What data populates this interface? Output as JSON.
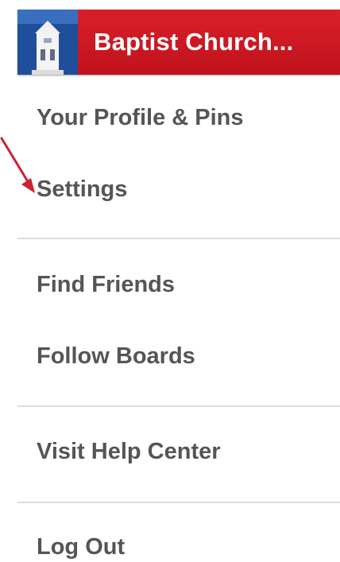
{
  "header": {
    "title": "Baptist Church...",
    "avatar_icon": "church-building-icon",
    "background_color": "#cc1820",
    "avatar_color": "#1f4f9a"
  },
  "menu": {
    "items": [
      {
        "label": "Your Profile & Pins"
      },
      {
        "label": "Settings"
      },
      {
        "label": "Find Friends"
      },
      {
        "label": "Follow Boards"
      },
      {
        "label": "Visit Help Center"
      },
      {
        "label": "Log Out"
      }
    ]
  },
  "annotation": {
    "arrow_icon": "red-arrow-icon",
    "arrow_color": "#cc2233",
    "points_to": "Settings"
  }
}
